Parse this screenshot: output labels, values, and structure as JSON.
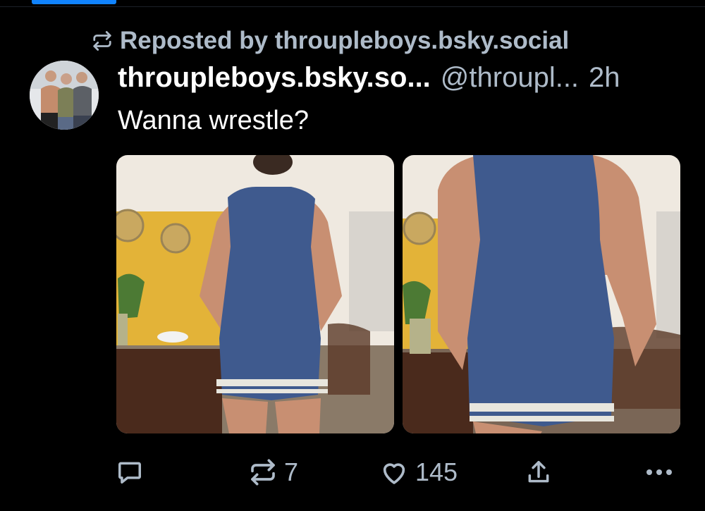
{
  "repost": {
    "icon": "repost-icon",
    "label": "Reposted by throupleboys.bsky.social"
  },
  "post": {
    "avatar_icon": "avatar",
    "display_name": "throupleboys.bsky.so...",
    "handle": "@throupl...",
    "time": "2h",
    "text": "Wanna wrestle?",
    "images": [
      {
        "name": "post-image-1"
      },
      {
        "name": "post-image-2"
      }
    ]
  },
  "actions": {
    "reply": {
      "icon": "reply-icon",
      "count": ""
    },
    "repost": {
      "icon": "repost-icon",
      "count": "7"
    },
    "like": {
      "icon": "heart-icon",
      "count": "145"
    },
    "share": {
      "icon": "share-icon"
    },
    "more": {
      "icon": "more-icon"
    }
  },
  "colors": {
    "background": "#000000",
    "muted_text": "#aebbc9",
    "accent": "#1083fe",
    "text": "#ffffff"
  }
}
